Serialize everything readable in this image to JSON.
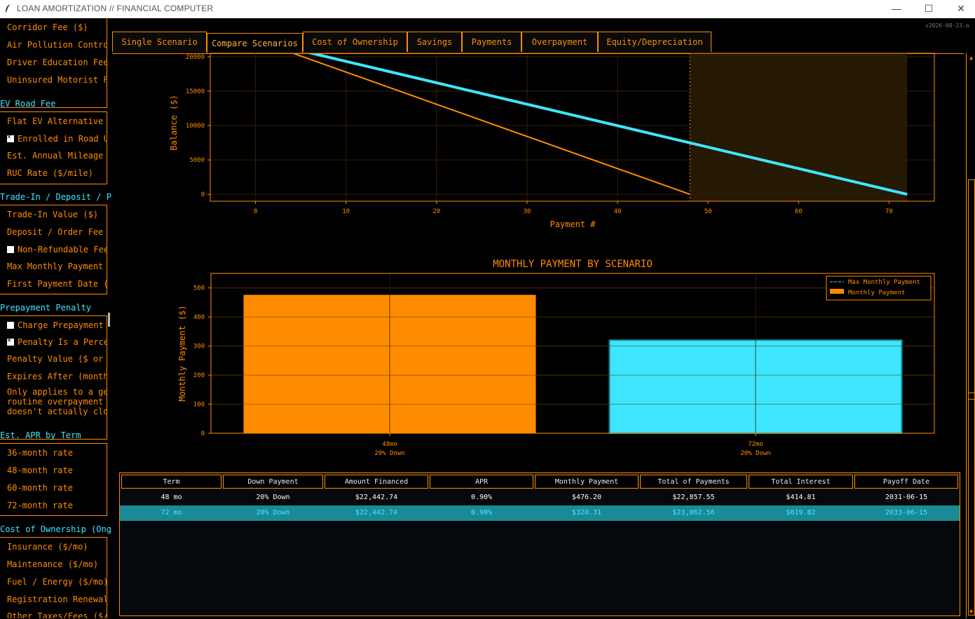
{
  "window": {
    "title": "LOAN AMORTIZATION // FINANCIAL COMPUTER",
    "version": "v2026-08-23.a"
  },
  "sidebar": {
    "group1": [
      "Corridor Fee ($)",
      "Air Pollution Control Fee",
      "Driver Education Fee",
      "Uninsured Motorist Fee"
    ],
    "ev_title": "EV Road Fee",
    "ev": [
      {
        "label": "Flat EV Alternative Fee",
        "checkbox": false
      },
      {
        "label": "Enrolled in Road Usage",
        "checkbox": true,
        "checked": true
      },
      {
        "label": "Est. Annual Mileage",
        "checkbox": false
      },
      {
        "label": "RUC Rate ($/mile)",
        "checkbox": false
      }
    ],
    "trade_title": "Trade-In / Deposit / P",
    "trade": [
      {
        "label": "Trade-In Value ($)",
        "checkbox": false
      },
      {
        "label": "Deposit / Order Fee",
        "checkbox": false
      },
      {
        "label": "Non-Refundable Fee",
        "checkbox": true,
        "checked": false
      },
      {
        "label": "Max Monthly Payment",
        "checkbox": false
      },
      {
        "label": "First Payment Date (Y",
        "checkbox": false
      }
    ],
    "prepay_title": "Prepayment Penalty",
    "prepay": [
      {
        "label": "Charge Prepayment Penalty",
        "checkbox": true,
        "checked": false
      },
      {
        "label": "Penalty Is a Percentage",
        "checkbox": true,
        "checked": true
      },
      {
        "label": "Penalty Value ($ or %)",
        "checkbox": false
      },
      {
        "label": "Expires After (months)",
        "checkbox": false
      }
    ],
    "prepay_note": [
      "Only applies to a gen",
      "routine overpayment o",
      "doesn't actually clos"
    ],
    "apr_title": "Est. APR by Term",
    "apr": [
      "36-month rate",
      "48-month rate",
      "60-month rate",
      "72-month rate"
    ],
    "cost_title": "Cost of Ownership (Ong",
    "cost": [
      "Insurance ($/mo)",
      "Maintenance ($/mo)",
      "Fuel / Energy ($/mo)",
      "Registration Renewal",
      "Other Taxes/Fees ($/y"
    ]
  },
  "tabs": [
    {
      "label": "Single Scenario",
      "active": false
    },
    {
      "label": "Compare Scenarios",
      "active": true
    },
    {
      "label": "Cost of Ownership",
      "active": false
    },
    {
      "label": "Savings",
      "active": false
    },
    {
      "label": "Payments",
      "active": false
    },
    {
      "label": "Overpayment",
      "active": false
    },
    {
      "label": "Equity/Depreciation",
      "active": false
    }
  ],
  "colors": {
    "accent": "#ff8c00",
    "cyan": "#3ee6ff",
    "selected_row": "#1a8a96"
  },
  "chart_data": [
    {
      "type": "line",
      "title": "",
      "xlabel": "Payment #",
      "ylabel": "Balance ($)",
      "xlim": [
        -5,
        75
      ],
      "ylim": [
        -1000,
        20500
      ],
      "xticks": [
        0,
        10,
        20,
        30,
        40,
        50,
        60,
        70
      ],
      "yticks": [
        0,
        5000,
        10000,
        15000,
        20000
      ],
      "shaded_region": [
        48,
        72
      ],
      "vline": 48,
      "series": [
        {
          "color": "#ff8c00",
          "x": [
            0,
            48
          ],
          "y": [
            22442.74,
            0
          ]
        },
        {
          "color": "#3ee6ff",
          "x": [
            0,
            72
          ],
          "y": [
            22442.74,
            0
          ]
        }
      ]
    },
    {
      "type": "bar",
      "title": "MONTHLY PAYMENT BY SCENARIO",
      "xlabel": "",
      "ylabel": "Monthly Payment ($)",
      "ylim": [
        0,
        550
      ],
      "yticks": [
        0,
        100,
        200,
        300,
        400,
        500
      ],
      "categories": [
        "48mo\n20% Down",
        "72mo\n20% Down"
      ],
      "category_lines": [
        [
          "48mo",
          "20% Down"
        ],
        [
          "72mo",
          "20% Down"
        ]
      ],
      "values": [
        476.2,
        320.31
      ],
      "bar_colors": [
        "#ff8c00",
        "#3ee6ff"
      ],
      "hline": {
        "name": "Max Monthly Payment",
        "value": 550
      },
      "series": [
        {
          "name": "Monthly Payment",
          "values": [
            476.2,
            320.31
          ]
        }
      ],
      "legend": "top-right"
    }
  ],
  "table": {
    "columns": [
      "Term",
      "Down Payment",
      "Amount Financed",
      "APR",
      "Monthly Payment",
      "Total of Payments",
      "Total Interest",
      "Payoff Date"
    ],
    "rows": [
      [
        "48 mo",
        "20% Down",
        "$22,442.74",
        "0.90%",
        "$476.20",
        "$22,857.55",
        "$414.81",
        "2031-06-15"
      ],
      [
        "72 mo",
        "20% Down",
        "$22,442.74",
        "0.90%",
        "$320.31",
        "$23,062.56",
        "$619.82",
        "2033-06-15"
      ]
    ],
    "selected_row": 1
  }
}
